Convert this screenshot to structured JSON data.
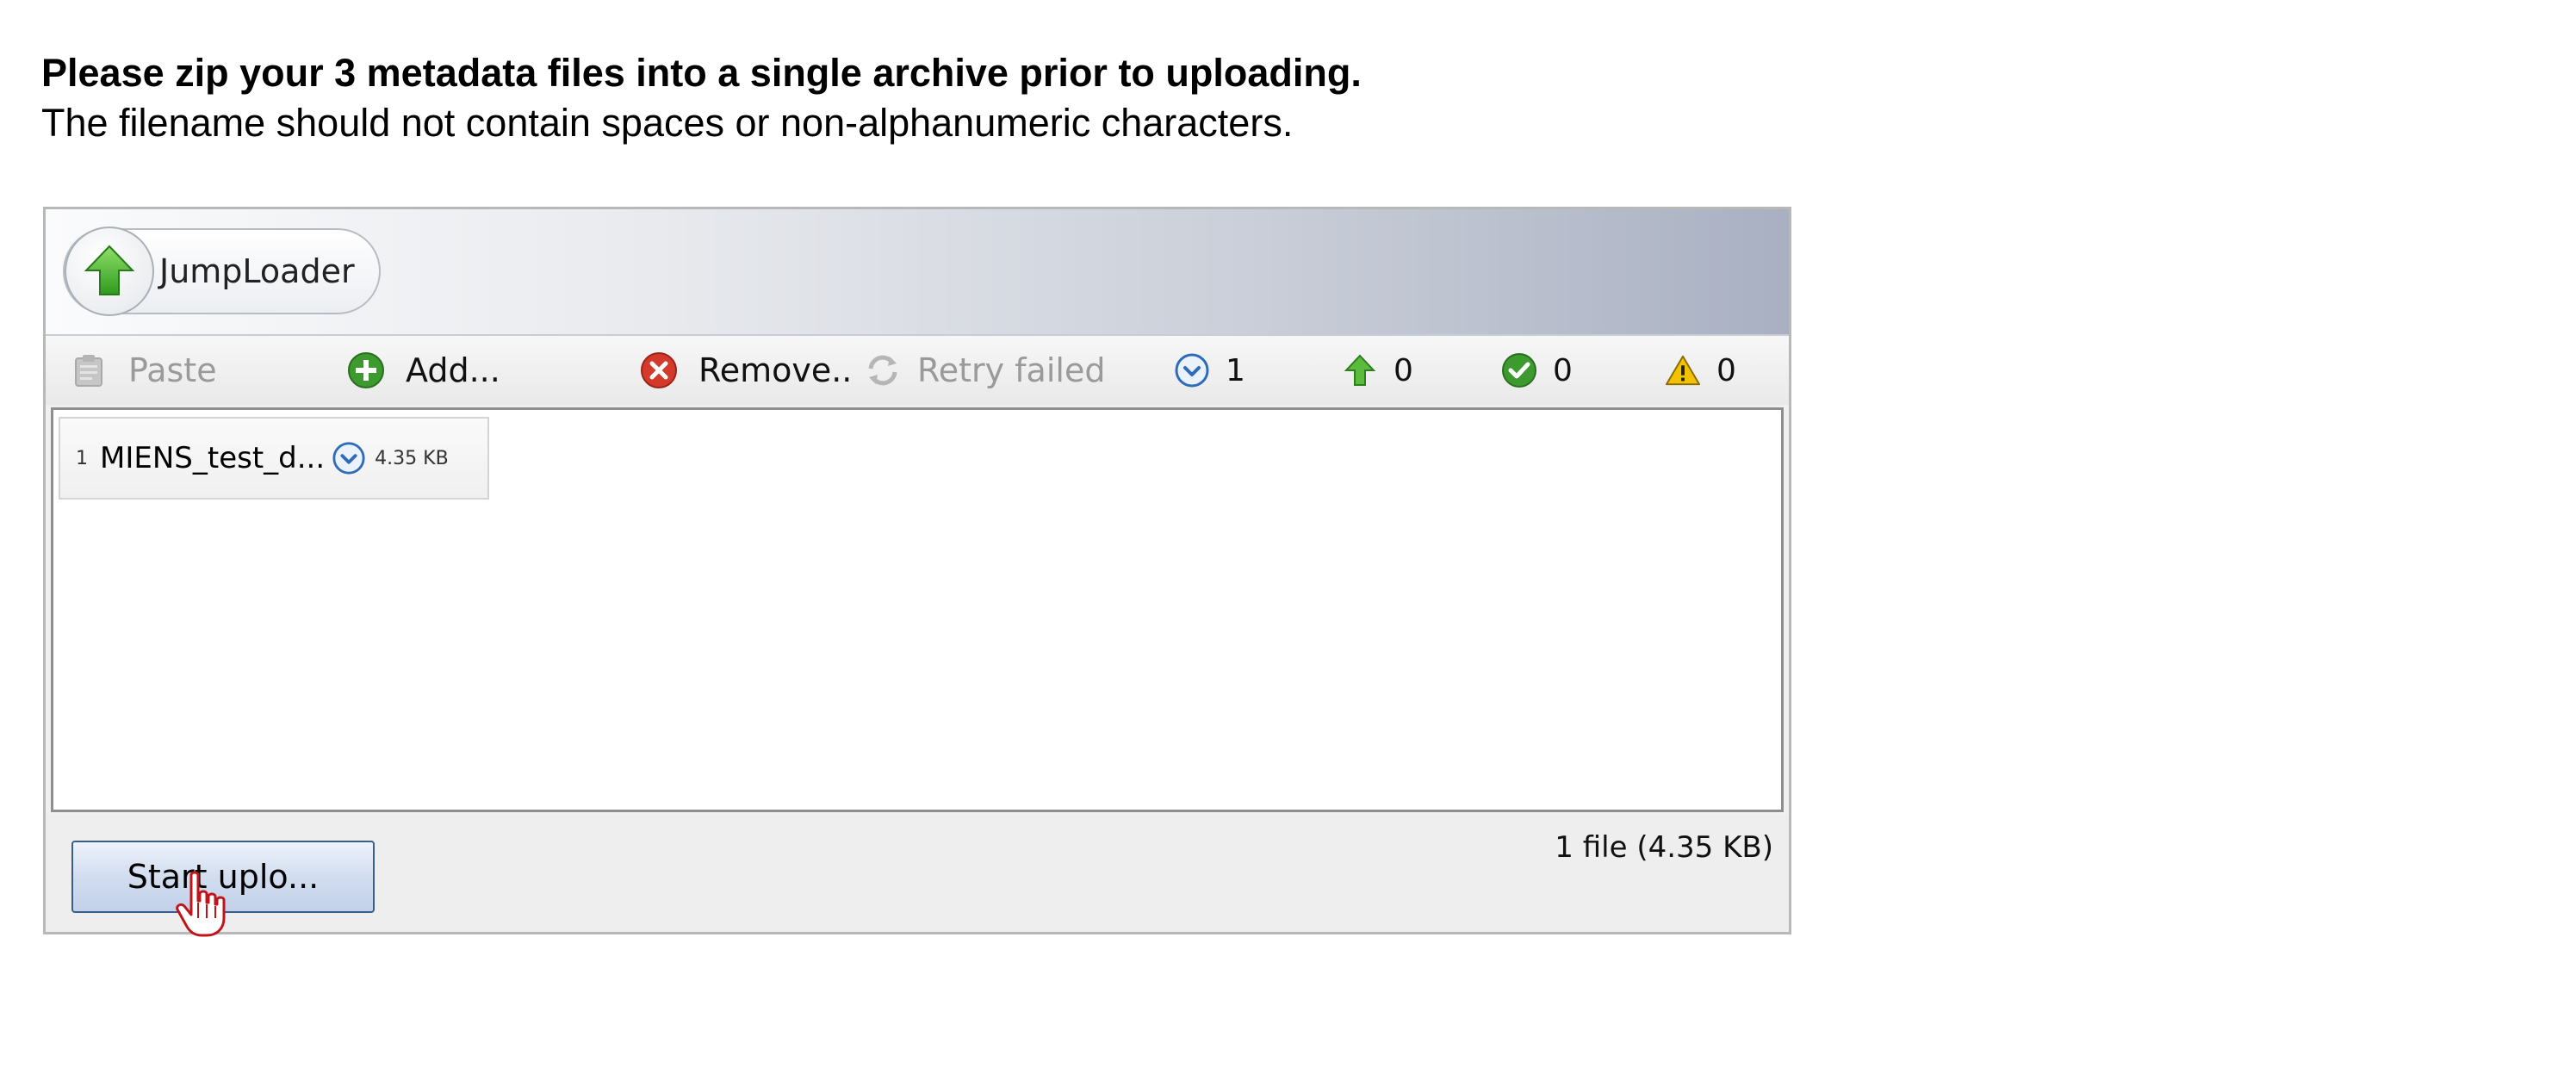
{
  "instructions": {
    "bold_line": "Please zip your 3 metadata files into a single archive prior to uploading.",
    "sub_line": "The filename should not contain spaces or non-alphanumeric characters."
  },
  "applet": {
    "title": "JumpLoader",
    "toolbar": {
      "paste_label": "Paste",
      "add_label": "Add...",
      "remove_label": "Remove..",
      "retry_label": "Retry failed",
      "pending_count": "1",
      "uploading_count": "0",
      "done_count": "0",
      "failed_count": "0"
    },
    "files": [
      {
        "index": "1",
        "name": "MIENS_test_d...",
        "size": "4.35 KB",
        "status_icon": "clock-icon"
      }
    ],
    "start_button_label": "Start uplo...",
    "status": "1 file (4.35 KB)"
  },
  "colors": {
    "add_green": "#3c9a2f",
    "remove_red": "#d33a2c",
    "status_blue": "#2f6bb8",
    "warning_yellow": "#f2c200"
  },
  "icons": {
    "logo": "up-arrow-icon",
    "paste": "clipboard-icon",
    "add": "plus-circle-icon",
    "remove": "x-circle-icon",
    "retry": "refresh-icon",
    "pending": "clock-icon",
    "uploading": "up-arrow-icon",
    "done": "check-circle-icon",
    "failed": "warning-triangle-icon",
    "cursor": "hand-cursor-icon"
  }
}
